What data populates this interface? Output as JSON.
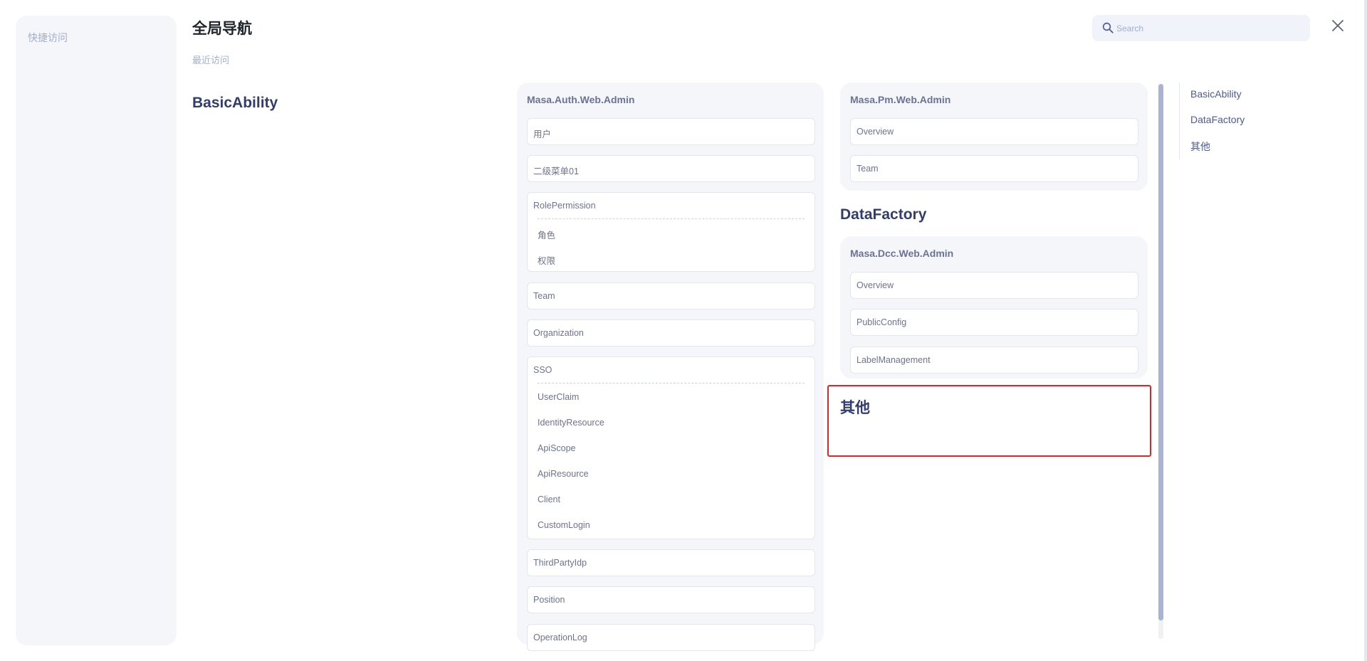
{
  "sidebar": {
    "title": "快捷访问"
  },
  "header": {
    "title": "全局导航",
    "recent_label": "最近访问"
  },
  "search": {
    "placeholder": "Search"
  },
  "sections": {
    "basic": "BasicAbility",
    "data": "DataFactory",
    "other": "其他"
  },
  "auth": {
    "title": "Masa.Auth.Web.Admin",
    "items": {
      "user": "用户",
      "menu01": "二级菜单01",
      "role_permission": "RolePermission",
      "role": "角色",
      "permission": "权限",
      "team": "Team",
      "organization": "Organization",
      "sso": "SSO",
      "user_claim": "UserClaim",
      "identity_resource": "IdentityResource",
      "api_scope": "ApiScope",
      "api_resource": "ApiResource",
      "client": "Client",
      "custom_login": "CustomLogin",
      "third_party_idp": "ThirdPartyIdp",
      "position": "Position",
      "operation_log": "OperationLog"
    }
  },
  "pm": {
    "title": "Masa.Pm.Web.Admin",
    "items": {
      "overview": "Overview",
      "team": "Team"
    }
  },
  "dcc": {
    "title": "Masa.Dcc.Web.Admin",
    "items": {
      "overview": "Overview",
      "public_config": "PublicConfig",
      "label_management": "LabelManagement"
    }
  },
  "anchors": [
    "BasicAbility",
    "DataFactory",
    "其他"
  ],
  "colors": {
    "accent": "#323d6f",
    "highlight": "#e8202a",
    "muted": "#a3aed0"
  }
}
